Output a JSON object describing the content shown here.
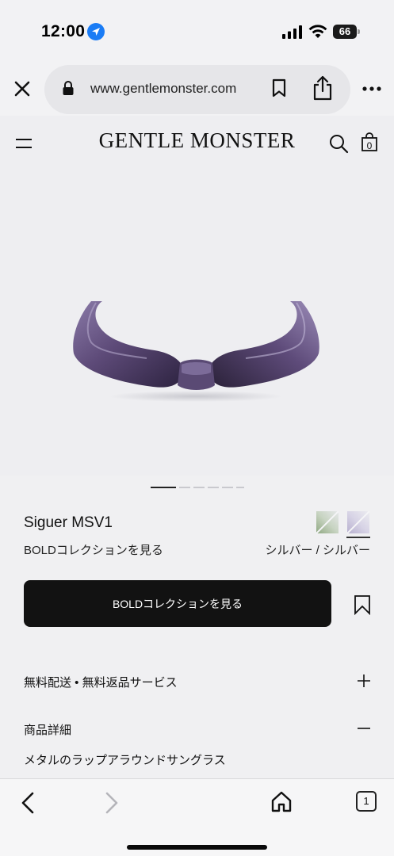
{
  "status_bar": {
    "time": "12:00",
    "battery": "66"
  },
  "browser": {
    "url": "www.gentlemonster.com",
    "tab_count": "1"
  },
  "site": {
    "brand": "GENTLE MONSTER",
    "bag_count": "0"
  },
  "carousel": {
    "total": 6,
    "active": 1
  },
  "product": {
    "name": "Siguer MSV1",
    "collection_link": "BOLDコレクションを見る",
    "color_name": "シルバー / シルバー",
    "swatches": [
      "silver-green",
      "silver-lavender"
    ],
    "selected_swatch": 2,
    "cta_label": "BOLDコレクションを見る"
  },
  "accordion": {
    "shipping_label": "無料配送 • 無料返品サービス",
    "details_label": "商品詳細",
    "details_description": "メタルのラップアラウンドサングラス"
  },
  "icons": {
    "location": "location-arrow-icon",
    "close": "close-icon",
    "lock": "lock-icon",
    "bookmark": "bookmark-icon",
    "share": "share-icon",
    "more": "more-icon",
    "menu": "hamburger-menu-icon",
    "search": "search-icon",
    "bag": "shopping-bag-icon",
    "wishlist": "wishlist-bookmark-icon",
    "plus": "plus-icon",
    "minus": "minus-icon",
    "back": "chevron-left-icon",
    "forward": "chevron-right-icon",
    "home": "home-icon",
    "tabs": "tabs-icon"
  },
  "colors": {
    "cta_background": "#121212",
    "page_background": "#eeeef1",
    "location_accent": "#1a7cf5",
    "lens_purple": "#5d4a78"
  }
}
